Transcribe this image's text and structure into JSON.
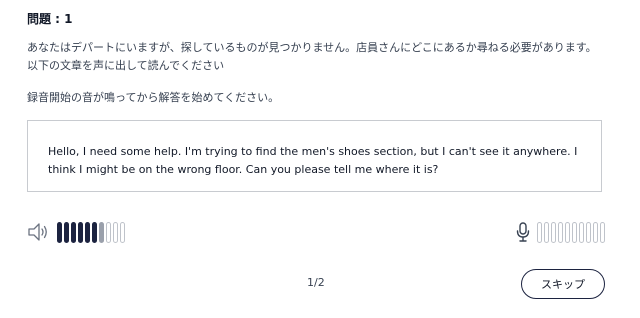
{
  "header": {
    "question_label": "問題 : 1"
  },
  "instructions": {
    "line1": "あなたはデパートにいますが、探しているものが見つかりません。店員さんにどこにあるか尋ねる必要があります。 以下の文章を声に出して読んでください",
    "line2": "録音開始の音が鳴ってから解答を始めてください。"
  },
  "passage": {
    "text": "Hello, I need some help. I'm trying to find the men's shoes section, but I can't see it anywhere. I think I might be on the wrong floor. Can you please tell me where it is?"
  },
  "playback_meter": {
    "icon": "speaker-icon",
    "total_bars": 10,
    "filled_bars": 6,
    "partial_bars": 1
  },
  "recording_meter": {
    "icon": "microphone-icon",
    "total_bars": 10,
    "filled_bars": 0
  },
  "footer": {
    "page_indicator": "1/2",
    "skip_label": "スキップ"
  },
  "colors": {
    "meter_filled": "#1c2340",
    "meter_partial": "#9aa0ab",
    "meter_empty_border": "#bfc3ca",
    "button_border": "#1c2340"
  }
}
